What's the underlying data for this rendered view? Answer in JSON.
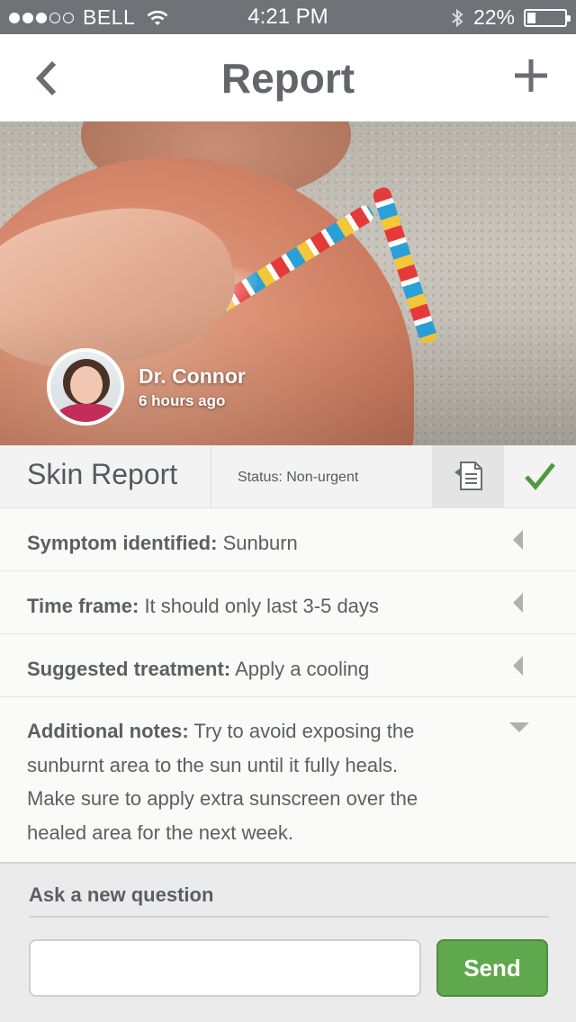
{
  "status_bar": {
    "carrier": "BELL",
    "time": "4:21 PM",
    "battery": "22%",
    "battery_level": 0.22,
    "signal_bars_filled": 3,
    "signal_bars_total": 5,
    "icons": [
      "wifi-icon",
      "bluetooth-icon",
      "battery-icon"
    ]
  },
  "nav": {
    "title": "Report",
    "back_icon": "chevron-left-icon",
    "add_icon": "plus-icon"
  },
  "doctor": {
    "name": "Dr. Connor",
    "time_ago": "6 hours ago"
  },
  "report": {
    "title": "Skin Report",
    "status": "Status: Non-urgent",
    "document_icon": "document-icon",
    "check_icon": "checkmark-icon",
    "rows": [
      {
        "label": "Symptom identified:",
        "value": "Sunburn",
        "state": "collapsed"
      },
      {
        "label": "Time frame:",
        "value": "It should only last 3-5 days",
        "state": "collapsed"
      },
      {
        "label": "Suggested treatment:",
        "value": "Apply a cooling",
        "state": "collapsed"
      },
      {
        "label": "Additional notes:",
        "value": "Try to avoid exposing the sunburnt area to the sun until it fully heals. Make sure to apply extra sunscreen over the healed area for the next week.",
        "state": "expanded"
      }
    ]
  },
  "ask": {
    "label": "Ask a new question",
    "input_value": "",
    "send_label": "Send"
  },
  "colors": {
    "status_bar": "#6f7378",
    "accent_green": "#5fa84d",
    "check_green": "#4f9a3c",
    "text": "#55595f"
  }
}
